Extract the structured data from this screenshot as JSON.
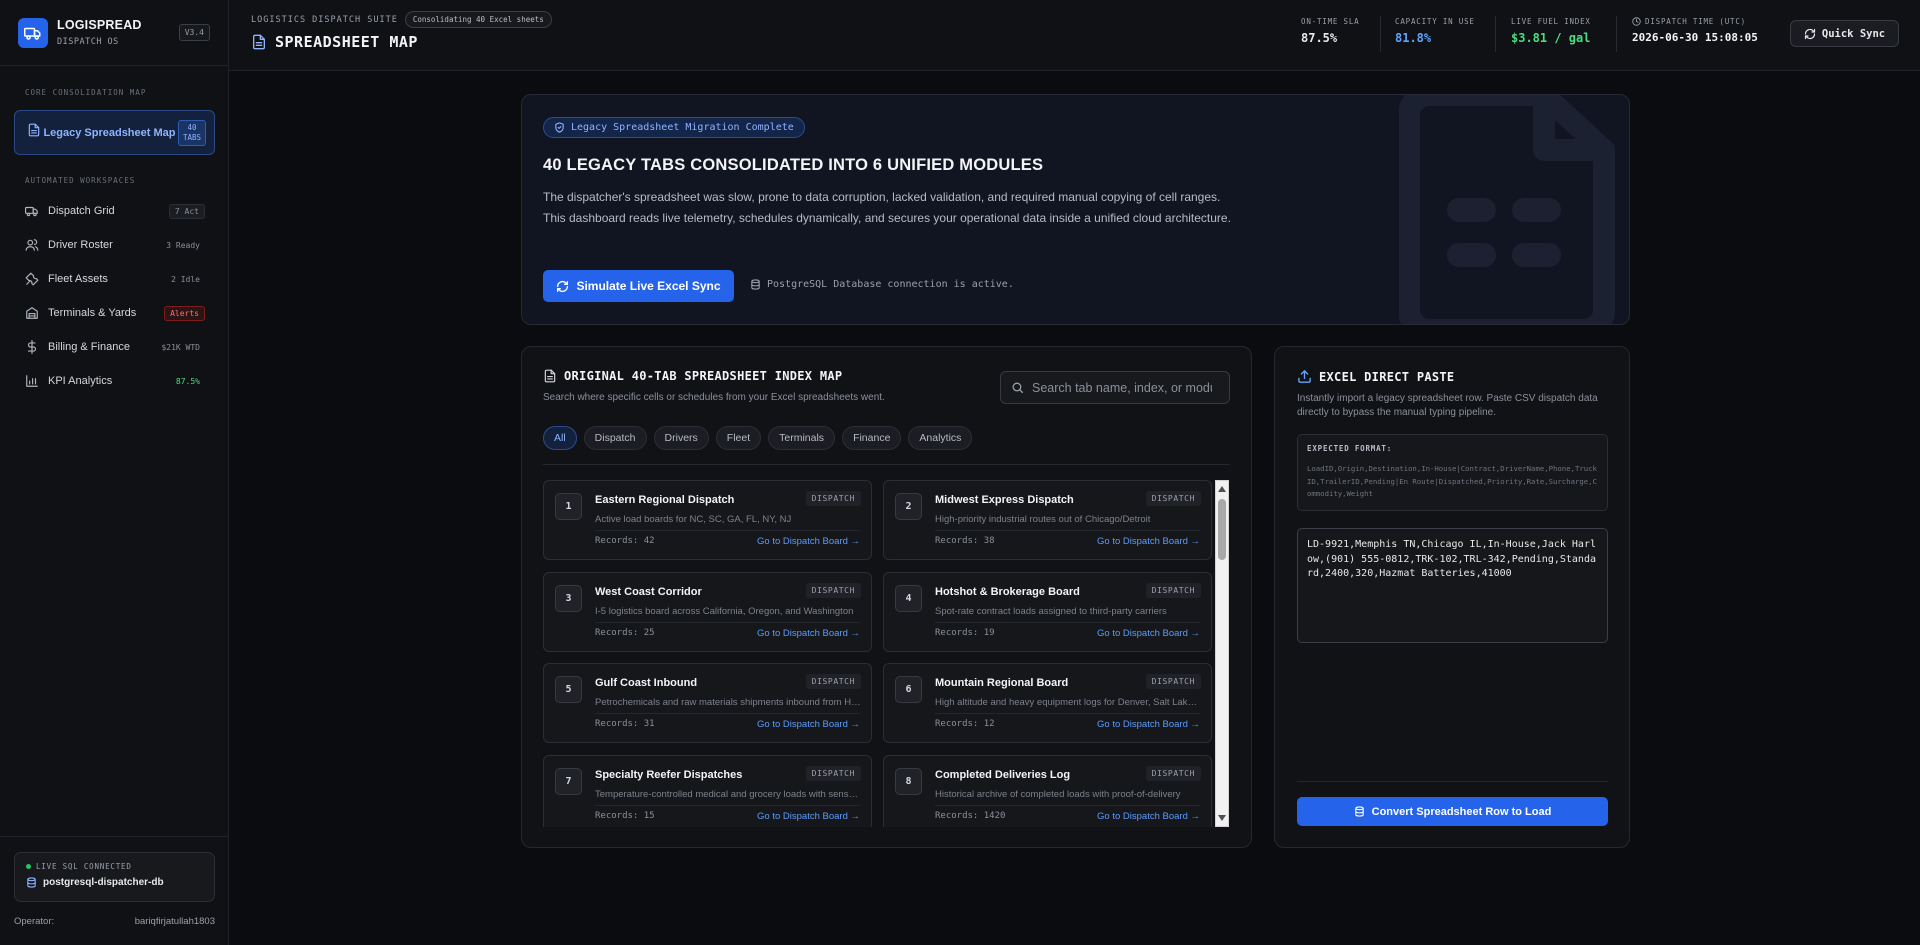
{
  "brand": {
    "name": "LOGISPREAD",
    "subtitle": "DISPATCH OS",
    "version": "V3.4"
  },
  "sidebar": {
    "core_label": "CORE CONSOLIDATION MAP",
    "legacy_item": {
      "label": "Legacy Spreadsheet Map",
      "badge_line1": "40",
      "badge_line2": "TABS"
    },
    "workspaces_label": "AUTOMATED WORKSPACES",
    "items": [
      {
        "label": "Dispatch Grid",
        "badge": "7 Act",
        "icon": "truck-icon"
      },
      {
        "label": "Driver Roster",
        "badge": "3 Ready",
        "icon": "users-icon"
      },
      {
        "label": "Fleet Assets",
        "badge": "2 Idle",
        "icon": "wrench-icon"
      },
      {
        "label": "Terminals & Yards",
        "badge": "Alerts",
        "icon": "warehouse-icon"
      },
      {
        "label": "Billing & Finance",
        "badge": "$21K WTD",
        "icon": "dollar-icon"
      },
      {
        "label": "KPI Analytics",
        "badge": "87.5%",
        "icon": "chart-icon"
      }
    ],
    "db_status": "LIVE SQL CONNECTED",
    "db_name": "postgresql-dispatcher-db",
    "operator_label": "Operator:",
    "operator_name": "bariqfirjatullah1803"
  },
  "header": {
    "suite": "LOGISTICS DISPATCH SUITE",
    "suite_chip": "Consolidating 40 Excel sheets",
    "title": "SPREADSHEET MAP",
    "metrics": [
      {
        "label": "ON-TIME SLA",
        "value": "87.5%",
        "color": "#e6e8ec"
      },
      {
        "label": "CAPACITY IN USE",
        "value": "81.8%",
        "color": "#60a5fa"
      },
      {
        "label": "LIVE FUEL INDEX",
        "value": "$3.81 / gal",
        "color": "#4ade80"
      },
      {
        "label": "DISPATCH TIME (UTC)",
        "value": "2026-06-30 15:08:05",
        "color": "#f3f4f6"
      }
    ],
    "quick_sync": "Quick Sync"
  },
  "hero": {
    "chip": "Legacy Spreadsheet Migration Complete",
    "title": "40 LEGACY TABS CONSOLIDATED INTO 6 UNIFIED MODULES",
    "description": "The dispatcher's spreadsheet was slow, prone to data corruption, lacked validation, and required manual copying of cell ranges. This dashboard reads live telemetry, schedules dynamically, and secures your operational data inside a unified cloud architecture.",
    "button": "Simulate Live Excel Sync",
    "db_status": "PostgreSQL Database connection is active."
  },
  "index": {
    "title": "ORIGINAL 40-TAB SPREADSHEET INDEX MAP",
    "subtitle": "Search where specific cells or schedules from your Excel spreadsheets went.",
    "search_placeholder": "Search tab name, index, or module...",
    "filters": [
      "All",
      "Dispatch",
      "Drivers",
      "Fleet",
      "Terminals",
      "Finance",
      "Analytics"
    ],
    "active_filter": "All",
    "cards": [
      {
        "num": "1",
        "title": "Eastern Regional Dispatch",
        "tag": "DISPATCH",
        "desc": "Active load boards for NC, SC, GA, FL, NY, NJ",
        "records": "Records: 42",
        "link": "Go to Dispatch Board →"
      },
      {
        "num": "2",
        "title": "Midwest Express Dispatch",
        "tag": "DISPATCH",
        "desc": "High-priority industrial routes out of Chicago/Detroit",
        "records": "Records: 38",
        "link": "Go to Dispatch Board →"
      },
      {
        "num": "3",
        "title": "West Coast Corridor",
        "tag": "DISPATCH",
        "desc": "I-5 logistics board across California, Oregon, and Washington",
        "records": "Records: 25",
        "link": "Go to Dispatch Board →"
      },
      {
        "num": "4",
        "title": "Hotshot & Brokerage Board",
        "tag": "DISPATCH",
        "desc": "Spot-rate contract loads assigned to third-party carriers",
        "records": "Records: 19",
        "link": "Go to Dispatch Board →"
      },
      {
        "num": "5",
        "title": "Gulf Coast Inbound",
        "tag": "DISPATCH",
        "desc": "Petrochemicals and raw materials shipments inbound from Houston",
        "records": "Records: 31",
        "link": "Go to Dispatch Board →"
      },
      {
        "num": "6",
        "title": "Mountain Regional Board",
        "tag": "DISPATCH",
        "desc": "High altitude and heavy equipment logs for Denver, Salt Lake City",
        "records": "Records: 12",
        "link": "Go to Dispatch Board →"
      },
      {
        "num": "7",
        "title": "Specialty Reefer Dispatches",
        "tag": "DISPATCH",
        "desc": "Temperature-controlled medical and grocery loads with sensors",
        "records": "Records: 15",
        "link": "Go to Dispatch Board →"
      },
      {
        "num": "8",
        "title": "Completed Deliveries Log",
        "tag": "DISPATCH",
        "desc": "Historical archive of completed loads with proof-of-delivery",
        "records": "Records: 1420",
        "link": "Go to Dispatch Board →"
      }
    ]
  },
  "paste": {
    "title": "EXCEL DIRECT PASTE",
    "subtitle": "Instantly import a legacy spreadsheet row. Paste CSV dispatch data directly to bypass the manual typing pipeline.",
    "format_label": "EXPECTED FORMAT:",
    "format_text": "LoadID,Origin,Destination,In-House|Contract,DriverName,Phone,TruckID,TrailerID,Pending|En Route|Dispatched,Priority,Rate,Surcharge,Commodity,Weight",
    "textarea_value": "LD-9921,Memphis TN,Chicago IL,In-House,Jack Harlow,(901) 555-0812,TRK-102,TRL-342,Pending,Standard,2400,320,Hazmat Batteries,41000",
    "button": "Convert Spreadsheet Row to Load"
  }
}
